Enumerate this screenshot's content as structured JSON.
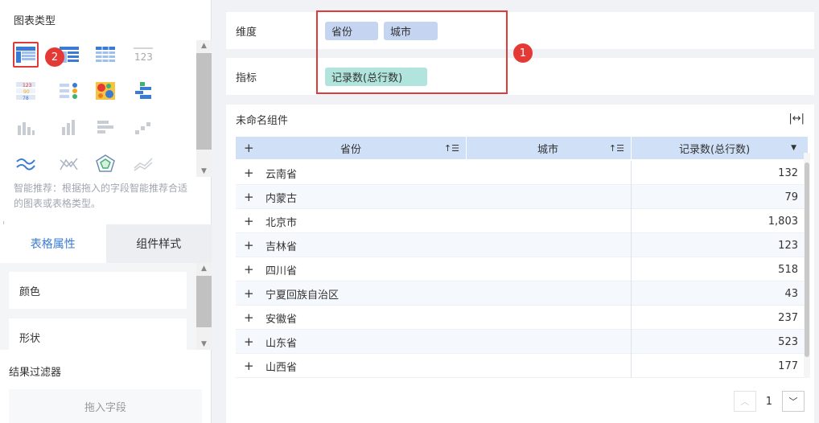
{
  "left": {
    "chart_type_title": "图表类型",
    "hint": "智能推荐：根据拖入的字段智能推荐合适的图表或表格类型。",
    "tabs": [
      {
        "label": "表格属性"
      },
      {
        "label": "组件样式"
      }
    ],
    "props": [
      {
        "label": "颜色"
      },
      {
        "label": "形状"
      }
    ],
    "filter_title": "结果过滤器",
    "filter_placeholder": "拖入字段"
  },
  "fields": {
    "dimension_label": "维度",
    "dimensions": [
      "省份",
      "城市"
    ],
    "measure_label": "指标",
    "measures": [
      "记录数(总行数)"
    ]
  },
  "badges": {
    "one": "1",
    "two": "2"
  },
  "component": {
    "title": "未命名组件",
    "columns": [
      "省份",
      "城市",
      "记录数(总行数)"
    ],
    "rows": [
      {
        "province": "云南省",
        "city": "",
        "count": "132"
      },
      {
        "province": "内蒙古",
        "city": "",
        "count": "79"
      },
      {
        "province": "北京市",
        "city": "",
        "count": "1,803"
      },
      {
        "province": "吉林省",
        "city": "",
        "count": "123"
      },
      {
        "province": "四川省",
        "city": "",
        "count": "518"
      },
      {
        "province": "宁夏回族自治区",
        "city": "",
        "count": "43"
      },
      {
        "province": "安徽省",
        "city": "",
        "count": "237"
      },
      {
        "province": "山东省",
        "city": "",
        "count": "523"
      },
      {
        "province": "山西省",
        "city": "",
        "count": "177"
      }
    ],
    "page": "1"
  },
  "colors": {
    "accent": "#3a7bd5",
    "highlight": "#e03b3b",
    "dim_pill": "#c5d4f0",
    "measure_pill": "#b0e4dc"
  }
}
